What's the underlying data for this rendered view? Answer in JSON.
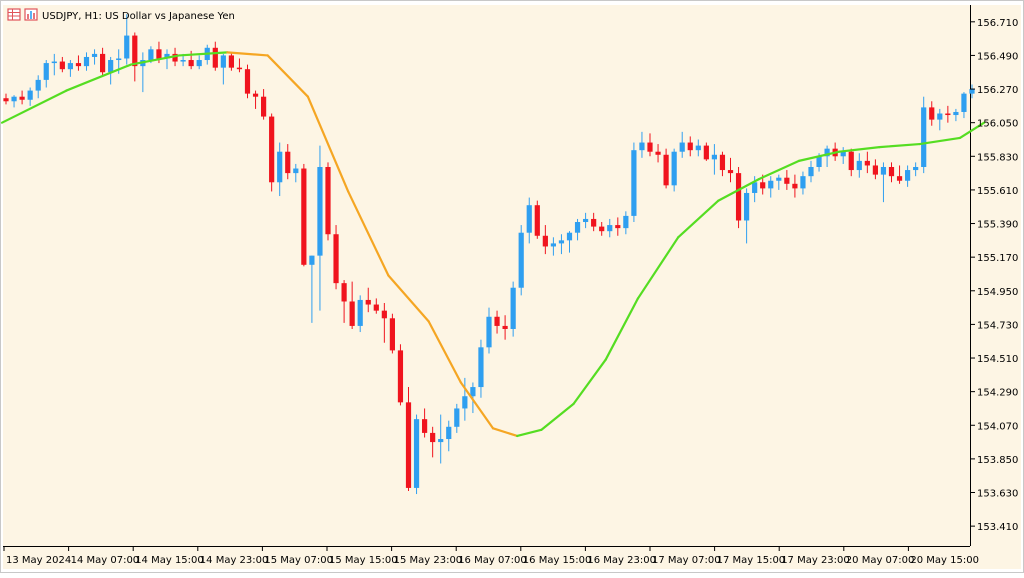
{
  "header": {
    "symbol_label": "USDJPY, H1:  US Dollar vs Japanese Yen"
  },
  "colors": {
    "background": "#fdf5e4",
    "bull_candle": "#2f9ff0",
    "bear_candle": "#f0141e",
    "ma_rising": "#55dd22",
    "ma_falling": "#f5a623",
    "axis_text": "#000000"
  },
  "chart_data": {
    "type": "candlestick",
    "title": "USDJPY, H1:  US Dollar vs Japanese Yen",
    "x_tick_labels": [
      "13 May 2024",
      "14 May 07:00",
      "14 May 15:00",
      "14 May 23:00",
      "15 May 07:00",
      "15 May 15:00",
      "15 May 23:00",
      "16 May 07:00",
      "16 May 15:00",
      "16 May 23:00",
      "17 May 07:00",
      "17 May 15:00",
      "17 May 23:00",
      "20 May 07:00",
      "20 May 15:00"
    ],
    "y_tick_labels": [
      "156.710",
      "156.490",
      "156.270",
      "156.050",
      "155.830",
      "155.610",
      "155.390",
      "155.170",
      "154.950",
      "154.730",
      "154.510",
      "154.290",
      "154.070",
      "153.850",
      "153.630",
      "153.410"
    ],
    "ylim": [
      153.28,
      156.82
    ],
    "series": [
      {
        "kind": "ohlc",
        "candles": [
          [
            156.21,
            156.24,
            156.17,
            156.19
          ],
          [
            156.19,
            156.23,
            156.15,
            156.22
          ],
          [
            156.22,
            156.26,
            156.17,
            156.2
          ],
          [
            156.2,
            156.28,
            156.16,
            156.26
          ],
          [
            156.26,
            156.36,
            156.21,
            156.33
          ],
          [
            156.33,
            156.46,
            156.28,
            156.44
          ],
          [
            156.44,
            156.5,
            156.36,
            156.45
          ],
          [
            156.45,
            156.48,
            156.38,
            156.4
          ],
          [
            156.4,
            156.46,
            156.35,
            156.44
          ],
          [
            156.44,
            156.49,
            156.39,
            156.42
          ],
          [
            156.42,
            156.51,
            156.39,
            156.48
          ],
          [
            156.48,
            156.53,
            156.43,
            156.5
          ],
          [
            156.5,
            156.54,
            156.36,
            156.38
          ],
          [
            156.38,
            156.48,
            156.3,
            156.46
          ],
          [
            156.46,
            156.53,
            156.37,
            156.47
          ],
          [
            156.47,
            156.76,
            156.43,
            156.62
          ],
          [
            156.62,
            156.64,
            156.32,
            156.42
          ],
          [
            156.42,
            156.51,
            156.25,
            156.46
          ],
          [
            156.46,
            156.55,
            156.44,
            156.53
          ],
          [
            156.53,
            156.58,
            156.44,
            156.47
          ],
          [
            156.47,
            156.53,
            156.4,
            156.5
          ],
          [
            156.5,
            156.54,
            156.42,
            156.45
          ],
          [
            156.45,
            156.5,
            156.42,
            156.46
          ],
          [
            156.46,
            156.52,
            156.4,
            156.42
          ],
          [
            156.42,
            156.49,
            156.4,
            156.46
          ],
          [
            156.46,
            156.56,
            156.43,
            156.54
          ],
          [
            156.54,
            156.58,
            156.39,
            156.41
          ],
          [
            156.41,
            156.5,
            156.3,
            156.49
          ],
          [
            156.49,
            156.51,
            156.39,
            156.41
          ],
          [
            156.41,
            156.47,
            156.38,
            156.4
          ],
          [
            156.4,
            156.43,
            156.21,
            156.24
          ],
          [
            156.24,
            156.26,
            156.14,
            156.22
          ],
          [
            156.22,
            156.27,
            156.07,
            156.09
          ],
          [
            156.09,
            156.11,
            155.6,
            155.66
          ],
          [
            155.66,
            155.92,
            155.57,
            155.86
          ],
          [
            155.86,
            155.91,
            155.68,
            155.72
          ],
          [
            155.72,
            155.78,
            155.66,
            155.75
          ],
          [
            155.75,
            155.78,
            155.11,
            155.12
          ],
          [
            155.12,
            154.96,
            154.74,
            155.18
          ],
          [
            155.18,
            155.9,
            154.82,
            155.76
          ],
          [
            155.76,
            155.79,
            155.28,
            155.32
          ],
          [
            155.32,
            155.38,
            154.96,
            155.0
          ],
          [
            155.0,
            155.02,
            154.74,
            154.88
          ],
          [
            154.88,
            155.01,
            154.7,
            154.72
          ],
          [
            154.72,
            154.92,
            154.68,
            154.89
          ],
          [
            154.89,
            154.97,
            154.81,
            154.86
          ],
          [
            154.86,
            154.9,
            154.8,
            154.82
          ],
          [
            154.82,
            154.87,
            154.61,
            154.77
          ],
          [
            154.77,
            154.8,
            154.54,
            154.56
          ],
          [
            154.56,
            154.6,
            154.2,
            154.22
          ],
          [
            154.22,
            154.32,
            153.64,
            153.66
          ],
          [
            153.66,
            154.14,
            153.62,
            154.11
          ],
          [
            154.11,
            154.18,
            153.99,
            154.02
          ],
          [
            154.02,
            154.06,
            153.86,
            153.96
          ],
          [
            153.96,
            154.14,
            153.82,
            153.98
          ],
          [
            153.98,
            154.1,
            153.9,
            154.06
          ],
          [
            154.06,
            154.21,
            154.02,
            154.18
          ],
          [
            154.18,
            154.38,
            154.1,
            154.26
          ],
          [
            154.26,
            154.35,
            154.15,
            154.32
          ],
          [
            154.32,
            154.63,
            154.25,
            154.58
          ],
          [
            154.58,
            154.84,
            154.54,
            154.78
          ],
          [
            154.78,
            154.82,
            154.67,
            154.72
          ],
          [
            154.72,
            154.79,
            154.63,
            154.7
          ],
          [
            154.7,
            155.01,
            154.65,
            154.97
          ],
          [
            154.97,
            155.38,
            154.92,
            155.33
          ],
          [
            155.33,
            155.56,
            155.26,
            155.51
          ],
          [
            155.51,
            155.54,
            155.29,
            155.31
          ],
          [
            155.31,
            155.38,
            155.19,
            155.24
          ],
          [
            155.24,
            155.3,
            155.18,
            155.26
          ],
          [
            155.26,
            155.32,
            155.19,
            155.28
          ],
          [
            155.28,
            155.34,
            155.2,
            155.33
          ],
          [
            155.33,
            155.42,
            155.28,
            155.4
          ],
          [
            155.4,
            155.46,
            155.36,
            155.42
          ],
          [
            155.42,
            155.46,
            155.34,
            155.37
          ],
          [
            155.37,
            155.4,
            155.31,
            155.34
          ],
          [
            155.34,
            155.42,
            155.3,
            155.38
          ],
          [
            155.38,
            155.43,
            155.31,
            155.36
          ],
          [
            155.36,
            155.47,
            155.32,
            155.44
          ],
          [
            155.44,
            155.92,
            155.4,
            155.87
          ],
          [
            155.87,
            155.99,
            155.82,
            155.92
          ],
          [
            155.92,
            155.98,
            155.83,
            155.86
          ],
          [
            155.86,
            155.91,
            155.79,
            155.84
          ],
          [
            155.84,
            155.88,
            155.62,
            155.64
          ],
          [
            155.64,
            155.88,
            155.6,
            155.86
          ],
          [
            155.86,
            155.99,
            155.82,
            155.92
          ],
          [
            155.92,
            155.96,
            155.83,
            155.87
          ],
          [
            155.87,
            155.94,
            155.83,
            155.9
          ],
          [
            155.9,
            155.92,
            155.8,
            155.81
          ],
          [
            155.81,
            155.91,
            155.71,
            155.84
          ],
          [
            155.84,
            155.86,
            155.7,
            155.74
          ],
          [
            155.74,
            155.82,
            155.66,
            155.72
          ],
          [
            155.72,
            155.76,
            155.36,
            155.41
          ],
          [
            155.41,
            155.62,
            155.26,
            155.59
          ],
          [
            155.59,
            155.7,
            155.53,
            155.66
          ],
          [
            155.66,
            155.71,
            155.58,
            155.62
          ],
          [
            155.62,
            155.7,
            155.56,
            155.67
          ],
          [
            155.67,
            155.71,
            155.61,
            155.69
          ],
          [
            155.69,
            155.74,
            155.61,
            155.65
          ],
          [
            155.65,
            155.71,
            155.56,
            155.62
          ],
          [
            155.62,
            155.73,
            155.58,
            155.7
          ],
          [
            155.7,
            155.8,
            155.66,
            155.76
          ],
          [
            155.76,
            155.85,
            155.73,
            155.83
          ],
          [
            155.83,
            155.9,
            155.76,
            155.88
          ],
          [
            155.88,
            155.92,
            155.8,
            155.83
          ],
          [
            155.83,
            155.89,
            155.78,
            155.86
          ],
          [
            155.86,
            155.88,
            155.7,
            155.74
          ],
          [
            155.74,
            155.85,
            155.69,
            155.8
          ],
          [
            155.8,
            155.86,
            155.72,
            155.77
          ],
          [
            155.77,
            155.81,
            155.68,
            155.71
          ],
          [
            155.71,
            155.79,
            155.53,
            155.76
          ],
          [
            155.76,
            155.79,
            155.66,
            155.7
          ],
          [
            155.7,
            155.77,
            155.65,
            155.67
          ],
          [
            155.67,
            155.77,
            155.63,
            155.74
          ],
          [
            155.74,
            155.79,
            155.7,
            155.76
          ],
          [
            155.76,
            156.22,
            155.72,
            156.15
          ],
          [
            156.15,
            156.19,
            156.03,
            156.07
          ],
          [
            156.07,
            156.14,
            156.0,
            156.11
          ],
          [
            156.11,
            156.16,
            156.05,
            156.1
          ],
          [
            156.1,
            156.14,
            156.06,
            156.12
          ],
          [
            156.12,
            156.25,
            156.08,
            156.24
          ],
          [
            156.24,
            156.3,
            156.21,
            156.27
          ]
        ]
      },
      {
        "kind": "moving-average",
        "points": [
          [
            0,
            156.05
          ],
          [
            8,
            156.26
          ],
          [
            16,
            156.43
          ],
          [
            22,
            156.49
          ],
          [
            28,
            156.51
          ],
          [
            33,
            156.49
          ],
          [
            38,
            156.22
          ],
          [
            43,
            155.6
          ],
          [
            48,
            155.05
          ],
          [
            53,
            154.75
          ],
          [
            57,
            154.35
          ],
          [
            61,
            154.05
          ],
          [
            64,
            154.0
          ],
          [
            67,
            154.04
          ],
          [
            71,
            154.21
          ],
          [
            75,
            154.5
          ],
          [
            79,
            154.9
          ],
          [
            84,
            155.3
          ],
          [
            89,
            155.54
          ],
          [
            94,
            155.68
          ],
          [
            99,
            155.8
          ],
          [
            104,
            155.86
          ],
          [
            109,
            155.89
          ],
          [
            114,
            155.91
          ],
          [
            119,
            155.95
          ],
          [
            122,
            156.05
          ]
        ],
        "rising_color": "#55dd22",
        "falling_color": "#f5a623"
      }
    ]
  }
}
